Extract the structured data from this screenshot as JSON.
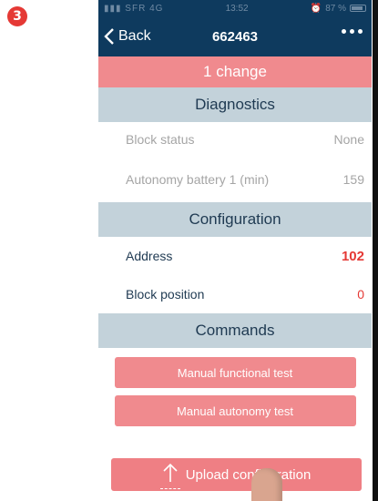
{
  "step_badge": "3",
  "status_bar": {
    "carrier": "SFR",
    "network": "4G",
    "time": "13:52",
    "battery_text": "87 %",
    "battery_level": 0.87
  },
  "nav": {
    "back_label": "Back",
    "title": "662463"
  },
  "changes_banner": "1 change",
  "diagnostics": {
    "header": "Diagnostics",
    "rows": [
      {
        "label": "Block status",
        "value": "None"
      },
      {
        "label": "Autonomy battery 1 (min)",
        "value": "159"
      }
    ]
  },
  "configuration": {
    "header": "Configuration",
    "rows": [
      {
        "label": "Address",
        "value": "102"
      },
      {
        "label": "Block position",
        "value": "0"
      }
    ]
  },
  "commands": {
    "header": "Commands",
    "buttons": [
      {
        "label": "Manual functional test"
      },
      {
        "label": "Manual autonomy test"
      }
    ]
  },
  "upload_button": {
    "label": "Upload configuration"
  },
  "colors": {
    "navbar": "#0e3a5e",
    "accent_pink": "#f08a8e",
    "section_header": "#c3d2da",
    "value_red": "#e53935"
  }
}
